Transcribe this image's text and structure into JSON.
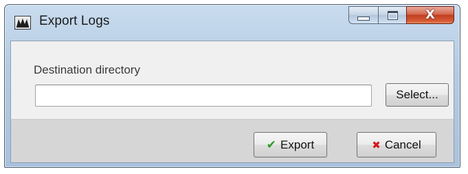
{
  "window": {
    "title": "Export Logs",
    "icons": {
      "app": "app-logo-icon",
      "minimize": "minimize-icon",
      "maximize": "maximize-icon",
      "close": "close-icon"
    },
    "close_glyph": "X"
  },
  "form": {
    "label": "Destination directory",
    "directory_value": "",
    "directory_placeholder": "",
    "select_label": "Select..."
  },
  "footer": {
    "export_label": "Export",
    "export_icon": "checkmark-icon",
    "export_icon_color": "#2c9a25",
    "cancel_label": "Cancel",
    "cancel_icon": "x-mark-icon",
    "cancel_icon_color": "#d6181e"
  }
}
